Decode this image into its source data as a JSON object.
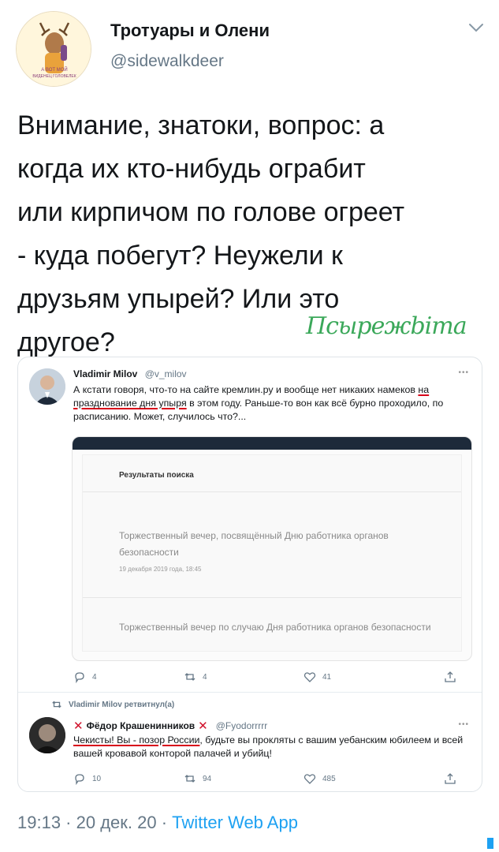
{
  "account": {
    "display_name": "Тротуары и Олени",
    "handle": "@sidewalkdeer",
    "avatar_caption_1": "А ВОТ МОЙ",
    "avatar_caption_2": "ВИДЕНЕЦ ГОЛОВЕЛЕК"
  },
  "tweet": {
    "lines": [
      "Внимание, знатоки, вопрос: а",
      "когда их кто-нибудь ограбит",
      "или кирпичом по голове огреет",
      "- куда побегут? Неужели к",
      "друзьям упырей? Или это",
      "другое?"
    ],
    "signature": "Псырежbima"
  },
  "quoted": {
    "name": "Vladimir Milov",
    "handle": "@v_milov",
    "text_pre": "А кстати говоря, что-то на сайте кремлин.ру и вообще нет никаких намеков ",
    "text_underlined": "на празднование дня упыря",
    "text_post": " в этом году. Раньше-то вон как всё бурно проходило, по расписанию. Может, случилось что?...",
    "screenshot": {
      "title": "Результаты поиска",
      "result_1": "Торжественный вечер, посвящённый Дню работника органов безопасности",
      "result_1_date": "19 декабря 2019 года, 18:45",
      "result_2": "Торжественный вечер по случаю Дня работника органов безопасности"
    },
    "stats": {
      "replies": "4",
      "retweets": "4",
      "likes": "41"
    }
  },
  "retweet": {
    "label": "Vladimir Milov ретвитнул(а)",
    "name": "Фёдор Крашенинников",
    "handle": "@Fyodorrrrr",
    "text_underlined": "Чекисты! Вы - позор России",
    "text_rest": ", будьте вы прокляты с вашим уебанским юбилеем и всей вашей кровавой конторой палачей и убийц!",
    "stats": {
      "replies": "10",
      "retweets": "94",
      "likes": "485"
    }
  },
  "footer": {
    "time": "19:13",
    "sep1": " · ",
    "date": "20 дек. 20",
    "sep2": " · ",
    "app": "Twitter Web App"
  },
  "colors": {
    "accent": "#1da1f2",
    "muted": "#657786",
    "signature": "#3ba85a",
    "underline": "#d8001a"
  }
}
